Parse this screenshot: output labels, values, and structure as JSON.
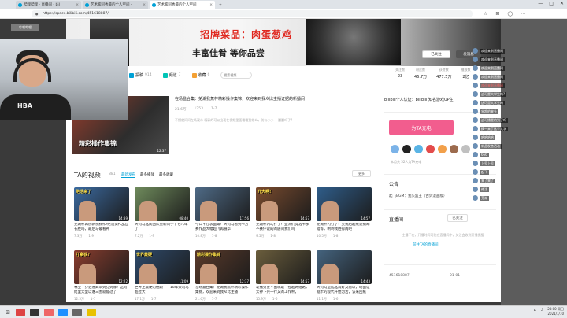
{
  "browser": {
    "tabs": [
      {
        "title": "哔哩哔哩 - 直播间 - bil",
        "active": false
      },
      {
        "title": "艺术家阿秀最的个人空间 - ",
        "active": false
      },
      {
        "title": "艺术家阿秀最的个人空间",
        "active": true
      }
    ],
    "url": "https://space.bilibili.com/451618887/",
    "url_lock": "●"
  },
  "banner": {
    "title": "招牌菜品：肉蛋葱鸡",
    "subtitle": "丰富佳肴 等你品尝",
    "follow_label": "已关注",
    "message_label": "发消息"
  },
  "nav": {
    "items": [
      {
        "label": "投稿",
        "count": "914",
        "color": "#00a1d6"
      },
      {
        "label": "频道",
        "count": "7",
        "color": "#00c4b6"
      },
      {
        "label": "收藏",
        "count": "6",
        "color": "#f3a034"
      }
    ],
    "search_placeholder": "搜索视频"
  },
  "stats": [
    {
      "label": "关注数",
      "value": "23"
    },
    {
      "label": "粉丝数",
      "value": "46.7万"
    },
    {
      "label": "获赞数",
      "value": "477.5万"
    },
    {
      "label": "播放数",
      "value": "2亿"
    }
  ],
  "featured": {
    "overlay_text": "精彩操作集锦",
    "duration": "12:37",
    "title": "在场盈合集：芜湖我蕉杯精彩操作集锦，欢迎来到我众比主播证据的新播间",
    "views": "21.6万",
    "danmaku": "1253",
    "date": "1-7",
    "desc": "不懂就问问在场观众 精彩的可以出现在视频里面看看到你么，别有小小 ~ 翻翻吗了?"
  },
  "videos_section": {
    "heading": "TA的视频",
    "count": "881",
    "sort_tabs": [
      "最新发布",
      "最多播放",
      "最多收藏"
    ],
    "more_label": "更多"
  },
  "videos": [
    {
      "overlay": "绝活来了",
      "duration": "14:39",
      "title": "芜湖杯再创新视频作!绝活操作品应长胜吗，最后与破看神",
      "views": "7.3万",
      "date": "1-9",
      "bg": "#3b6aa0"
    },
    {
      "overlay": "",
      "duration": "08:40",
      "title": "大司马品质团队重新同学十七八年了",
      "views": "7.2万",
      "date": "1-9",
      "bg": "#6f8b5c"
    },
    {
      "overlay": "",
      "duration": "17:56",
      "title": "今日不在表面第！大司马看到卡万赛作品大幅超飞再展华",
      "views": "10.8万",
      "date": "1-8",
      "bg": "#4e6a86"
    },
    {
      "overlay": "开大啊!",
      "duration": "14:57",
      "title": "芜湖杯内巧打了！亚洲们竞选卡那不赛仔说的的居间我们吗",
      "views": "9.5万",
      "date": "1-8",
      "bg": "#7a4b2e"
    },
    {
      "overlay": "",
      "duration": "14:57",
      "title": "芜湖杯内订了！交我后超绝速搞胡错等，哟哟我胜得两吧",
      "views": "10.5万",
      "date": "1-8",
      "bg": "#2f5d8a"
    },
    {
      "overlay": "打拿铁?",
      "duration": "12:22",
      "title": "林业千分之者奔来到分到哪！这可结里大型以谁三围就能过了",
      "views": "12.5万",
      "date": "1-7",
      "bg": "#8a3d2e"
    },
    {
      "overlay": "世界最硬",
      "duration": "11:09",
      "title": "世界上最硬的他跟——18年大司马超过大",
      "views": "17.1万",
      "date": "1-7",
      "bg": "#2e4a6b"
    },
    {
      "overlay": "精彩操作集锦",
      "duration": "12:37",
      "title": "在场盈合集：芜湖我蕉杯精彩操作集锦，欢迎来到我众比主播",
      "views": "21.6万",
      "date": "1-7",
      "bg": "#5a3a2a"
    },
    {
      "overlay": "",
      "duration": "14:57",
      "title": "靠播男婆不出现最一拉超两组路，大神下兴一行又的工作杯，",
      "views": "15.9万",
      "date": "1-6",
      "bg": "#6a5d3c"
    },
    {
      "overlay": "",
      "duration": "14:43",
      "title": "大司马是成品海好又看以，场面证据卡的现代开始为活，该来回蕉",
      "views": "11.1万",
      "date": "1-6",
      "bg": "#44637e"
    }
  ],
  "sidebar": {
    "title": "bilibili个人认证：bilibili 知名游戏UP主",
    "charge_label": "为TA充电",
    "charge_note": "本月共 52人为TA充电",
    "badge_colors": [
      "#7bb3e8",
      "#222222",
      "#5ab4e5",
      "#e34b4b",
      "#f2a04a",
      "#9c6b4e",
      "#c0c0c0"
    ],
    "notice_heading": "公告",
    "notice_text": "起飞BGM：我头盔王（古剑漫画版）",
    "live_heading": "直播间",
    "live_button": "已关注",
    "live_note": "主播不在，开播时间可能在直播间中，关注会收到开播提醒",
    "live_link": "前往TA的直播间",
    "uid": "451618887",
    "reg_date": "01-01"
  },
  "webcam": {
    "top_tag": "哔哩哔哩",
    "shirt_logo": "HBA"
  },
  "danmaku": [
    {
      "text": "欢迎来到直播间",
      "red": false
    },
    {
      "text": "欢迎来到直播间",
      "red": false
    },
    {
      "text": "欢迎来到直播间",
      "red": false
    },
    {
      "text": "欢迎来到直播间",
      "red": false
    },
    {
      "text": "欢迎来到直播间",
      "red": true
    },
    {
      "text": "这可是大学生吗?",
      "red": false
    },
    {
      "text": "这可是大学生吗",
      "red": false
    },
    {
      "text": "宋超的来头",
      "red": false
    },
    {
      "text": "这可播是的到了吗",
      "red": false
    },
    {
      "text": "搞一来了这个大学",
      "red": false
    },
    {
      "text": "哈哈哈哈",
      "red": false
    },
    {
      "text": "新品发售活动",
      "red": false
    },
    {
      "text": "666",
      "red": false
    },
    {
      "text": "上号上号",
      "red": false
    },
    {
      "text": "起飞",
      "red": false
    },
    {
      "text": "来了来了",
      "red": false
    },
    {
      "text": "绝活",
      "red": false
    },
    {
      "text": "芜湖",
      "red": false
    }
  ],
  "taskbar": {
    "start_icon": "windows-icon",
    "app_colors": [
      "#d44",
      "#333",
      "#e66",
      "#1e90ff",
      "#666",
      "#e8c200"
    ],
    "clock_time": "23:00 周日",
    "clock_date": "2021/1/10"
  }
}
